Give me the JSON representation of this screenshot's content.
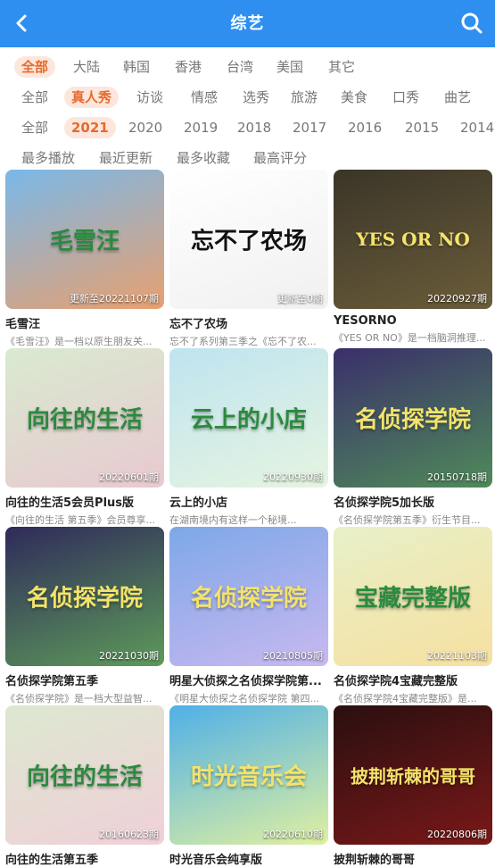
{
  "header": {
    "title": "综艺",
    "back_icon": "back-arrow-icon",
    "search_icon": "search-icon",
    "bg_color": "#2f8ff0"
  },
  "filters": {
    "region": [
      "全部",
      "大陆",
      "韩国",
      "香港",
      "台湾",
      "美国",
      "其它"
    ],
    "region_active": 0,
    "genre": [
      "全部",
      "真人秀",
      "访谈",
      "情感",
      "选秀",
      "旅游",
      "美食",
      "口秀",
      "曲艺"
    ],
    "genre_active": 1,
    "year": [
      "全部",
      "2021",
      "2020",
      "2019",
      "2018",
      "2017",
      "2016",
      "2015",
      "2014"
    ],
    "year_active": 1,
    "sort": [
      "最多播放",
      "最近更新",
      "最多收藏",
      "最高评分"
    ],
    "active_color": "#e46b2e",
    "active_bg": "#fde6dc"
  },
  "cards": [
    {
      "name": "毛雪汪",
      "desc": "《毛雪汪》是一档以原生朋友关...",
      "badge": "更新至20221107期",
      "art": "毛雪汪",
      "color": "#7ab8e8",
      "color2": "#e8a070"
    },
    {
      "name": "忘不了农场",
      "desc": "忘不了系列第三季之《忘不了农...",
      "badge": "更新至0期",
      "art": "忘不了农场",
      "color": "#ffffff",
      "color2": "#f0f0f0"
    },
    {
      "name": "YESORNO",
      "desc": "《YES OR NO》是一档脑洞推理...",
      "badge": "20220927期",
      "art": "YES OR NO",
      "color": "#3a3528",
      "color2": "#6b5d3a"
    },
    {
      "name": "向往的生活5会员Plus版",
      "desc": "《向往的生活 第五季》会员尊享...",
      "badge": "20220601期",
      "art": "向往的生活",
      "color": "#d9ead0",
      "color2": "#e8c9d0"
    },
    {
      "name": "云上的小店",
      "desc": "在湖南境内有这样一个秘境...",
      "badge": "20220930期",
      "art": "云上的小店",
      "color": "#bfe4f0",
      "color2": "#e6f4e0"
    },
    {
      "name": "名侦探学院5加长版",
      "desc": "《名侦探学院第五季》衍生节目...",
      "badge": "20150718期",
      "art": "名侦探学院",
      "color": "#3a2f6a",
      "color2": "#4f8a5a"
    },
    {
      "name": "名侦探学院第五季",
      "desc": "《名侦探学院》是一档大型益智...",
      "badge": "20221030期",
      "art": "名侦探学院",
      "color": "#2f2a5a",
      "color2": "#5d9a5a"
    },
    {
      "name": "明星大侦探之名侦探学院第...",
      "desc": "《明星大侦探之名侦探学院 第四...",
      "badge": "20210805期",
      "art": "名侦探学院",
      "color": "#7ea8e8",
      "color2": "#c8b8f0"
    },
    {
      "name": "名侦探学院4宝藏完整版",
      "desc": "《名侦探学院4宝藏完整版》是...",
      "badge": "20221103期",
      "art": "宝藏完整版",
      "color": "#e8f0c8",
      "color2": "#f6e0a0"
    },
    {
      "name": "向往的生活第五季",
      "desc": "",
      "badge": "20160623期",
      "art": "向往的生活",
      "color": "#dce8d0",
      "color2": "#f0d0d8"
    },
    {
      "name": "时光音乐会纯享版",
      "desc": "",
      "badge": "20220610期",
      "art": "时光音乐会",
      "color": "#4fb0e8",
      "color2": "#e0f0a0"
    },
    {
      "name": "披荆斩棘的哥哥",
      "desc": "",
      "badge": "20220806期",
      "art": "披荆斩棘的哥哥",
      "color": "#2a0f10",
      "color2": "#7a1818"
    }
  ]
}
